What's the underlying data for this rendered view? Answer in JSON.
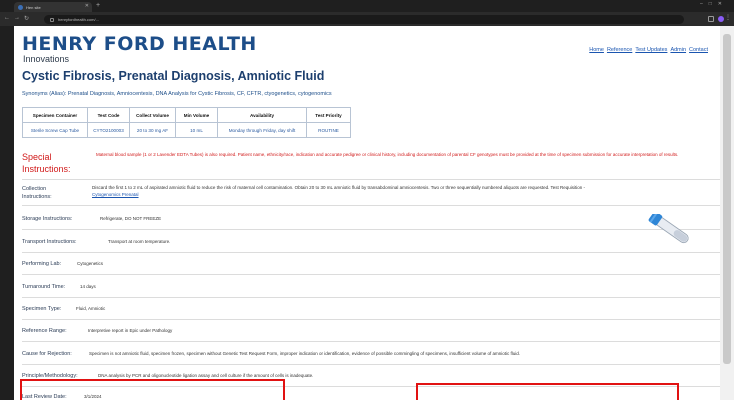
{
  "browser": {
    "tab_title": "Hen site",
    "url": "henryfordhealth.com/..."
  },
  "logo": {
    "main": "HENRY FORD HEALTH",
    "sub": "Innovations"
  },
  "nav": {
    "links": [
      "Home",
      "Reference",
      "Test Updates",
      "Admin",
      "Contact"
    ]
  },
  "page": {
    "title": "Cystic Fibrosis, Prenatal Diagnosis, Amniotic Fluid",
    "synonyms": "Synonyms (Alias): Prenatal Diagnosis, Amniocentesis, DNA Analysis for Cystic Fibrosis, CF, CFTR, ctyogenetics, cytogenomics"
  },
  "specimen_table": {
    "headers": [
      "Specimen Container",
      "Test Code",
      "Collect Volume",
      "Min Volume",
      "Availability",
      "Test Priority"
    ],
    "row": [
      "Sterile Screw Cap Tube",
      "CYTO2100003",
      "20 to 30 mg AF",
      "10 mL",
      "Monday through Friday, day shift",
      "ROUTINE"
    ]
  },
  "special": {
    "label": "Special Instructions:",
    "text": "Maternal blood sample (1 or 2 Lavender EDTA Tubes) is also required. Patient name, ethnicity/race, indication and accurate pedigree or clinical history, including documentation of parental CF genotypes must be provided at the time of specimen submission for accurate interpretation of results."
  },
  "collection": {
    "label": "Collection Instructions:",
    "text": "Discard the first 1 to 2 mL of aspirated amniotic fluid to reduce the risk of maternal cell contamination. Obtain 20 to 30 mL amniotic fluid by transabdominal amniocentesis. Two or three sequentially numbered aliquots are requested. Test Requisition -",
    "link": "Cytogenomics Prenatal"
  },
  "rows": {
    "storage": {
      "label": "Storage Instructions:",
      "value": "Refrigerate, DO NOT FREEZE"
    },
    "transport": {
      "label": "Transport Instructions:",
      "value": "Transport at room temperature."
    },
    "lab": {
      "label": "Performing Lab:",
      "value": "Cytogenetics"
    },
    "tat": {
      "label": "Turnaround Time:",
      "value": "14 days"
    },
    "type": {
      "label": "Specimen Type:",
      "value": "Fluid, Amniotic"
    },
    "range": {
      "label": "Reference Range:",
      "value": "Interpretive report in Epic under Pathology"
    },
    "rejection": {
      "label": "Cause for Rejection:",
      "value": "Specimen is not amniotic fluid, specimen frozen, specimen without Genetic Test Request Form, improper indication or identification, evidence of possible commingling of specimens, insufficient volume of amniotic fluid."
    },
    "method": {
      "label": "Principle/Methodology:",
      "value": "DNA analysis by PCR and oligonucleotide ligation assay and cell culture if the amount of cells is inadequate."
    },
    "review": {
      "label": "Last Review Date:",
      "value": "3/1/2024"
    }
  },
  "colors": {
    "brand": "#1d4e89",
    "special": "#d11a1a",
    "highlight_box": "#e11212"
  }
}
